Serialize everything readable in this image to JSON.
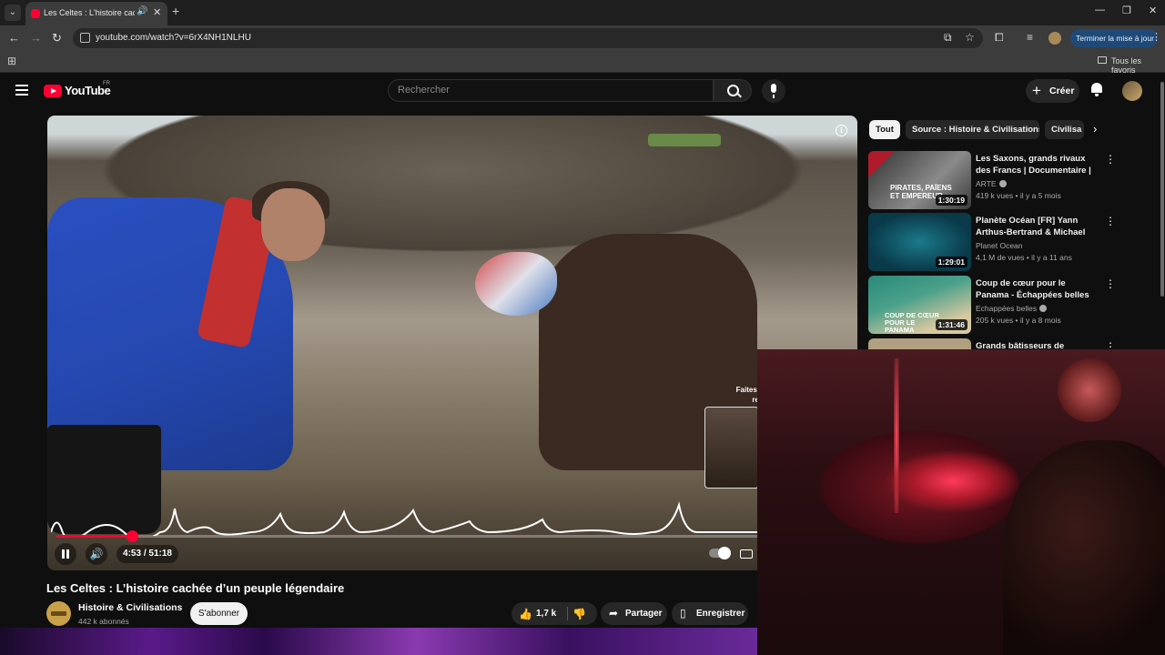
{
  "browser": {
    "tab_title": "Les Celtes : L'histoire cachée d'un peuple légendaire",
    "url": "youtube.com/watch?v=6rX4NH1NLHU",
    "update_button": "Terminer la mise à jour",
    "bookmarks_folder": "Tous les favoris"
  },
  "header": {
    "logo": "YouTube",
    "region": "FR",
    "search_placeholder": "Rechercher",
    "create_label": "Créer"
  },
  "player": {
    "current_time": "4:53",
    "duration": "51:18",
    "time_display": "4:53 / 51:18",
    "progress_fraction": 0.095,
    "hint_text": "Faites gli... rech..."
  },
  "video": {
    "title": "Les Celtes : L’histoire cachée d’un peuple légendaire",
    "channel_name": "Histoire & Civilisations",
    "subscribers": "442 k abonnés",
    "subscribe_label": "S'abonner",
    "likes": "1,7 k",
    "share_label": "Partager",
    "save_label": "Enregistrer"
  },
  "sidebar": {
    "chips": [
      "Tout",
      "Source : Histoire & Civilisations",
      "Civilisa"
    ],
    "recommendations": [
      {
        "title": "Les Saxons, grands rivaux des Francs | Documentaire | ARTE",
        "channel": "ARTE",
        "verified": true,
        "views": "419 k vues",
        "age": "il y a 5 mois",
        "duration": "1:30:19",
        "thumb_text": "PIRATES, PAÏENS ET EMPEREUR"
      },
      {
        "title": "Planète Océan [FR] Yann Arthus-Bertrand & Michael ...",
        "channel": "Planet Ocean",
        "verified": false,
        "views": "4,1 M de vues",
        "age": "il y a 11 ans",
        "duration": "1:29:01"
      },
      {
        "title": "Coup de cœur pour le Panama - Échappées belles",
        "channel": "Echappées belles",
        "verified": true,
        "views": "205 k vues",
        "age": "il y a 8 mois",
        "duration": "1:31:46",
        "thumb_text": "COUP DE CŒUR POUR LE PANAMA"
      },
      {
        "title": "Grands bâtisseurs de France :",
        "channel": "",
        "verified": false,
        "views": "",
        "age": "",
        "duration": ""
      }
    ]
  },
  "colors": {
    "accent": "#ff0033",
    "background": "#0f0f0f",
    "chip_bg": "#272727"
  }
}
